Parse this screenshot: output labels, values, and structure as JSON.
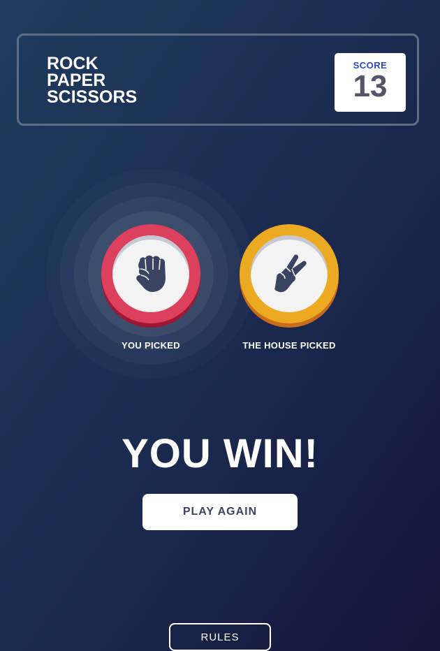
{
  "header": {
    "logo_lines": [
      "ROCK",
      "PAPER",
      "SCISSORS"
    ],
    "score_label": "SCORE",
    "score_value": "13"
  },
  "game": {
    "player": {
      "label": "YOU PICKED",
      "choice": "rock",
      "icon": "rock-fist-icon",
      "color": "#dd405d",
      "winner_highlight": true
    },
    "house": {
      "label": "THE HOUSE PICKED",
      "choice": "scissors",
      "icon": "scissors-hand-icon",
      "color": "#eca922"
    },
    "result_text": "YOU WIN!",
    "play_again_label": "PLAY AGAIN"
  },
  "footer": {
    "rules_label": "RULES"
  },
  "colors": {
    "background_start": "#1f3756",
    "background_end": "#141539",
    "header_outline": "#606e85",
    "score_label": "#2a46c0",
    "score_value": "#565468",
    "icon": "#3b4363"
  }
}
